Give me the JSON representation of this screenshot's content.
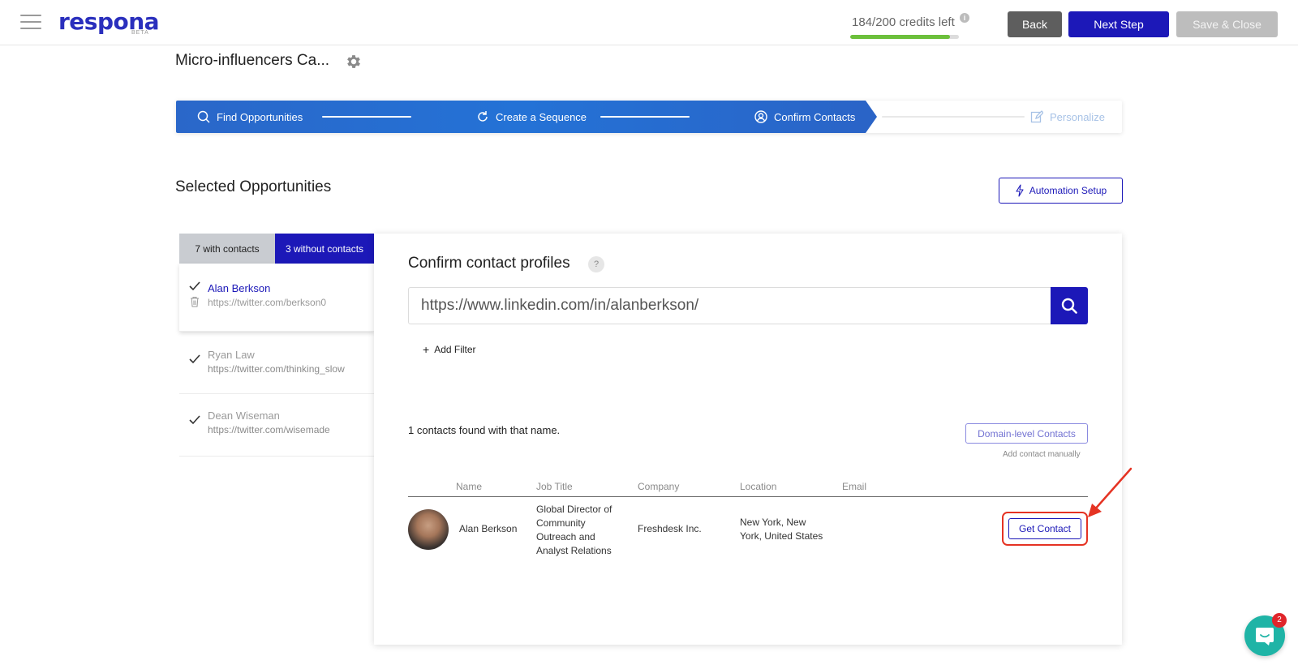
{
  "header": {
    "logo_text": "respona",
    "logo_badge": "BETA",
    "credits_text": "184/200 credits left",
    "credits_info": "i",
    "credits_fraction": 0.92,
    "back_label": "Back",
    "next_label": "Next Step",
    "save_label": "Save & Close"
  },
  "campaign": {
    "title": "Micro-influencers Ca..."
  },
  "stepper": {
    "steps": [
      {
        "label": "Find Opportunities",
        "state": "done"
      },
      {
        "label": "Create a Sequence",
        "state": "done"
      },
      {
        "label": "Confirm Contacts",
        "state": "current"
      },
      {
        "label": "Personalize",
        "state": "upcoming"
      }
    ]
  },
  "section": {
    "title": "Selected Opportunities",
    "automation_label": "Automation Setup"
  },
  "tabs": {
    "with_contacts": "7 with contacts",
    "without_contacts": "3 without contacts"
  },
  "opportunities": [
    {
      "name": "Alan Berkson",
      "url": "https://twitter.com/berkson0",
      "active": true
    },
    {
      "name": "Ryan Law",
      "url": "https://twitter.com/thinking_slow",
      "active": false
    },
    {
      "name": "Dean Wiseman",
      "url": "https://twitter.com/wisemade",
      "active": false
    }
  ],
  "confirm": {
    "title": "Confirm contact profiles",
    "help": "?",
    "search_value": "https://www.linkedin.com/in/alanberkson/",
    "add_filter_label": "Add Filter",
    "found_text": "1 contacts found with that name.",
    "domain_contacts_label": "Domain-level Contacts",
    "add_manually_label": "Add contact manually"
  },
  "table": {
    "columns": [
      "Name",
      "Job Title",
      "Company",
      "Location",
      "Email"
    ],
    "rows": [
      {
        "name": "Alan Berkson",
        "job_title_lines": [
          "Global Director of",
          "Community",
          "Outreach and",
          "Analyst Relations"
        ],
        "company": "Freshdesk Inc.",
        "location_lines": [
          "New York, New",
          "York, United States"
        ],
        "email": "",
        "action_label": "Get Contact"
      }
    ]
  },
  "chat": {
    "badge_count": "2"
  },
  "colors": {
    "brand": "#1c18b8",
    "stepper_blue": "#2472d6",
    "credits_green": "#6cc03b",
    "annotation_red": "#e53323",
    "chat_teal": "#1fb4a6"
  },
  "icons": [
    "hamburger-icon",
    "gear-icon",
    "search-icon",
    "refresh-icon",
    "user-circle-icon",
    "edit-icon",
    "lightning-icon",
    "check-icon",
    "trash-icon",
    "chat-icon",
    "info-icon"
  ]
}
